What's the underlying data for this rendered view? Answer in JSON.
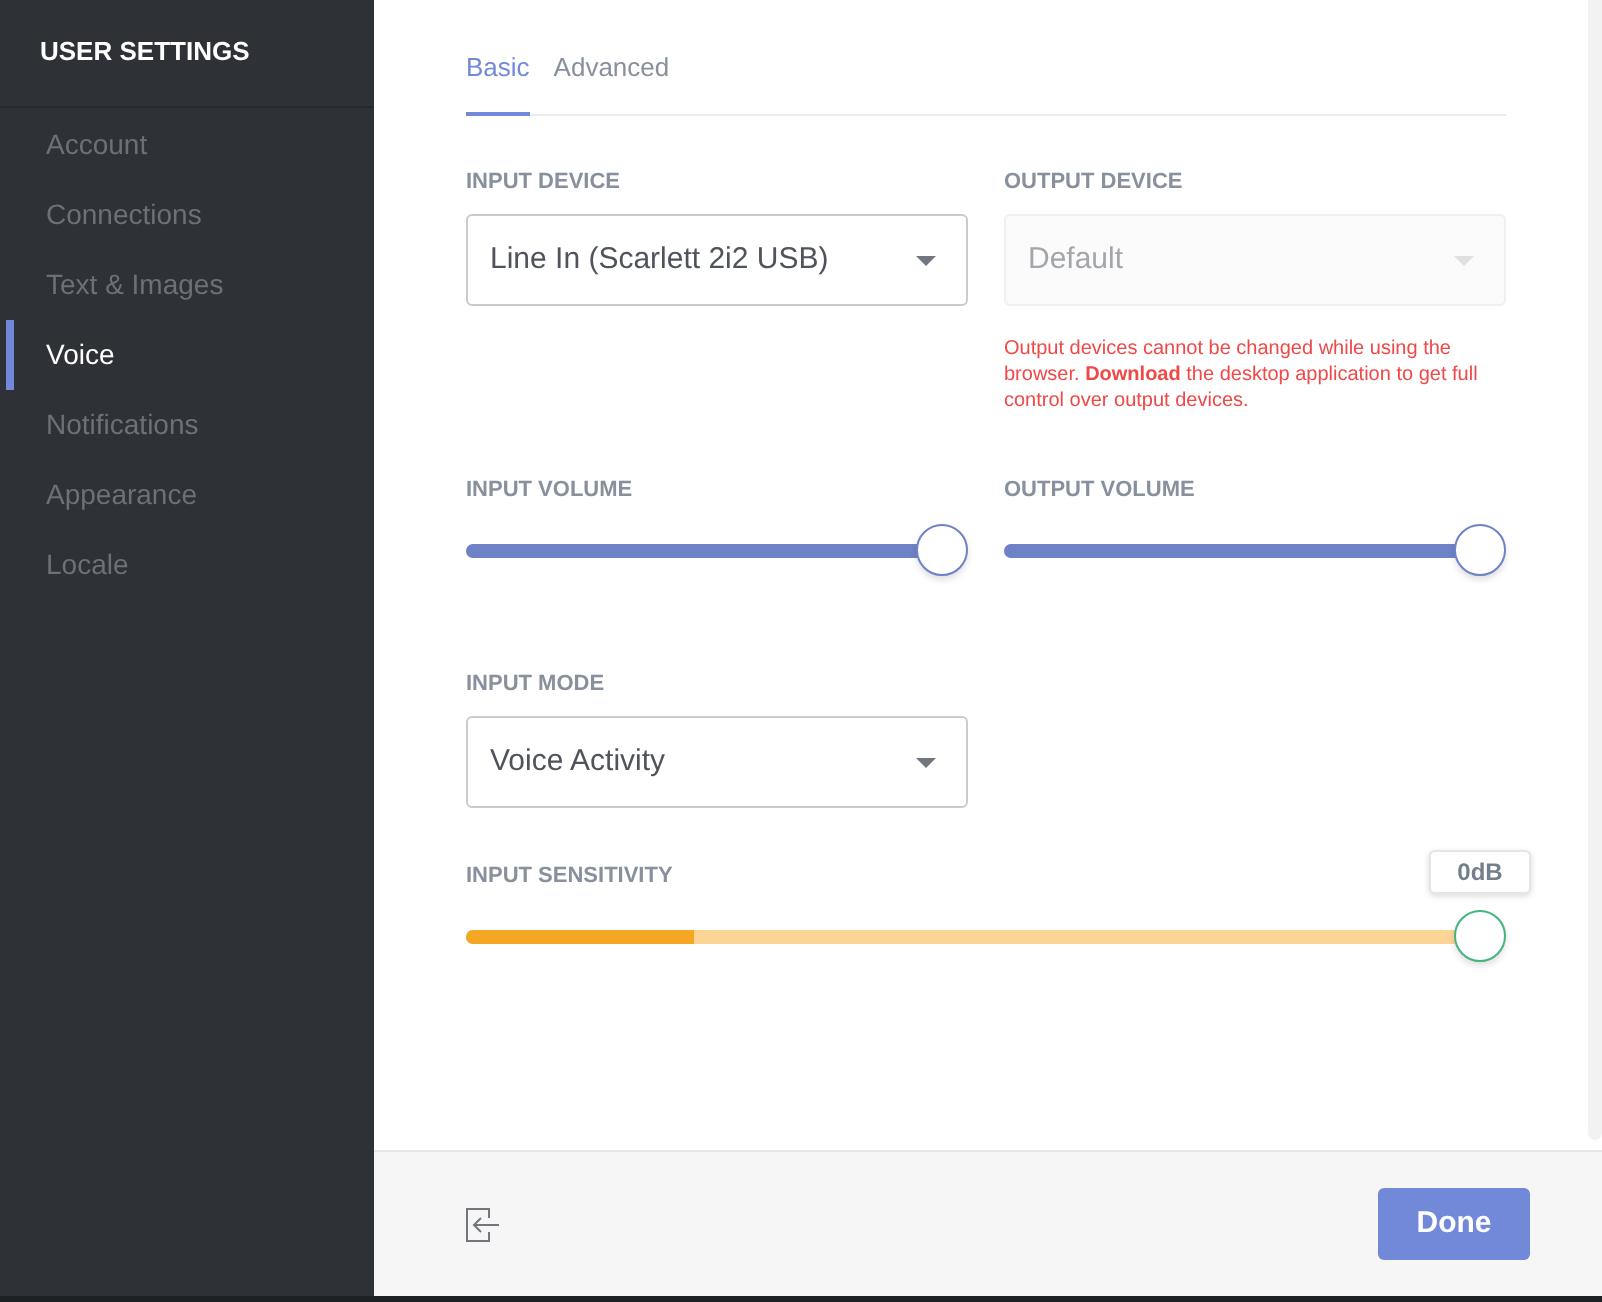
{
  "sidebar": {
    "title": "USER SETTINGS",
    "items": [
      {
        "label": "Account",
        "selected": false
      },
      {
        "label": "Connections",
        "selected": false
      },
      {
        "label": "Text & Images",
        "selected": false
      },
      {
        "label": "Voice",
        "selected": true
      },
      {
        "label": "Notifications",
        "selected": false
      },
      {
        "label": "Appearance",
        "selected": false
      },
      {
        "label": "Locale",
        "selected": false
      }
    ]
  },
  "tabs": [
    {
      "label": "Basic",
      "selected": true
    },
    {
      "label": "Advanced",
      "selected": false
    }
  ],
  "devices": [
    {
      "label": "INPUT DEVICE",
      "value": "Line In (Scarlett 2i2 USB)",
      "disabled": false
    },
    {
      "label": "OUTPUT DEVICE",
      "value": "Default",
      "disabled": true,
      "note": "Output devices cannot be changed while using the browser. **Download** the desktop application to get full control over output devices."
    }
  ],
  "volumes": [
    {
      "label": "INPUT VOLUME",
      "level": 1
    },
    {
      "label": "OUTPUT VOLUME",
      "level": 1
    }
  ],
  "input_mode": {
    "label": "INPUT MODE",
    "value": "Voice Activity"
  },
  "input_sensitivity": {
    "label": "INPUT SENSITIVITY",
    "level": 1,
    "reading": "0dB",
    "meter": {
      "level": 0.22
    }
  },
  "footer": {
    "button": "Done"
  }
}
